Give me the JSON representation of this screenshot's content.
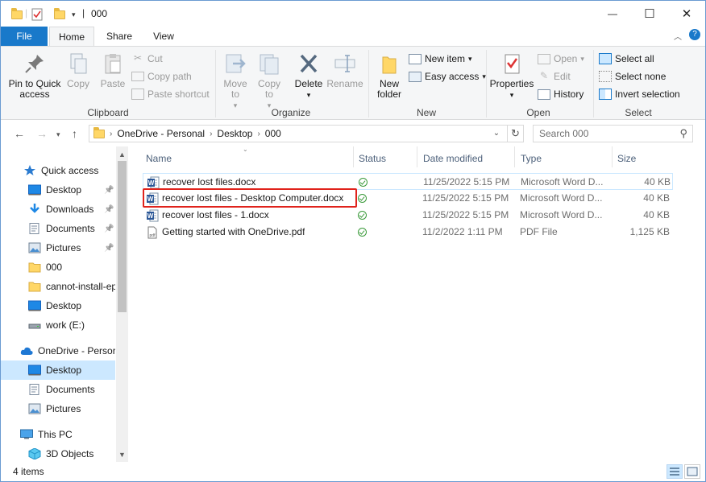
{
  "window": {
    "title": "000",
    "minimize": "—",
    "maximize": "☐",
    "close": "✕"
  },
  "tabs": {
    "file": "File",
    "home": "Home",
    "share": "Share",
    "view": "View"
  },
  "ribbon": {
    "clipboard": {
      "label": "Clipboard",
      "pin": "Pin to Quick access",
      "copy": "Copy",
      "paste": "Paste",
      "cut": "Cut",
      "copy_path": "Copy path",
      "paste_shortcut": "Paste shortcut"
    },
    "organize": {
      "label": "Organize",
      "move_to": "Move to",
      "copy_to": "Copy to",
      "delete": "Delete",
      "rename": "Rename"
    },
    "new": {
      "label": "New",
      "new_folder": "New folder",
      "new_item": "New item",
      "easy_access": "Easy access"
    },
    "open": {
      "label": "Open",
      "properties": "Properties",
      "open": "Open",
      "edit": "Edit",
      "history": "History"
    },
    "select": {
      "label": "Select",
      "select_all": "Select all",
      "select_none": "Select none",
      "invert": "Invert selection"
    }
  },
  "address": {
    "crumbs": [
      "OneDrive - Personal",
      "Desktop",
      "000"
    ],
    "search_placeholder": "Search 000"
  },
  "sidebar": {
    "items": [
      {
        "label": "Quick access",
        "icon": "star-icon"
      },
      {
        "label": "Desktop",
        "icon": "desktop-icon",
        "pinned": true
      },
      {
        "label": "Downloads",
        "icon": "download-icon",
        "pinned": true
      },
      {
        "label": "Documents",
        "icon": "documents-icon",
        "pinned": true
      },
      {
        "label": "Pictures",
        "icon": "pictures-icon",
        "pinned": true
      },
      {
        "label": "000",
        "icon": "folder-icon"
      },
      {
        "label": "cannot-install-ep",
        "icon": "folder-icon"
      },
      {
        "label": "Desktop",
        "icon": "desktop-icon"
      },
      {
        "label": "work (E:)",
        "icon": "drive-icon"
      },
      {
        "label": "OneDrive - Persor",
        "icon": "cloud-icon"
      },
      {
        "label": "Desktop",
        "icon": "desktop-icon",
        "selected": true
      },
      {
        "label": "Documents",
        "icon": "documents-icon"
      },
      {
        "label": "Pictures",
        "icon": "pictures-icon"
      },
      {
        "label": "This PC",
        "icon": "pc-icon"
      },
      {
        "label": "3D Objects",
        "icon": "cube-icon"
      }
    ]
  },
  "columns": {
    "name": "Name",
    "status": "Status",
    "date": "Date modified",
    "type": "Type",
    "size": "Size"
  },
  "files": [
    {
      "name": "recover lost files.docx",
      "date": "11/25/2022 5:15 PM",
      "type": "Microsoft Word D...",
      "size": "40 KB",
      "kind": "word"
    },
    {
      "name": "recover lost files - Desktop Computer.docx",
      "date": "11/25/2022 5:15 PM",
      "type": "Microsoft Word D...",
      "size": "40 KB",
      "kind": "word"
    },
    {
      "name": "recover lost files - 1.docx",
      "date": "11/25/2022 5:15 PM",
      "type": "Microsoft Word D...",
      "size": "40 KB",
      "kind": "word"
    },
    {
      "name": "Getting started with OneDrive.pdf",
      "date": "11/2/2022 1:11 PM",
      "type": "PDF File",
      "size": "1,125 KB",
      "kind": "pdf"
    }
  ],
  "status": {
    "count": "4 items"
  },
  "colors": {
    "accent": "#1979ca",
    "selection": "#cce8ff",
    "highlight_box": "#e0231c"
  }
}
